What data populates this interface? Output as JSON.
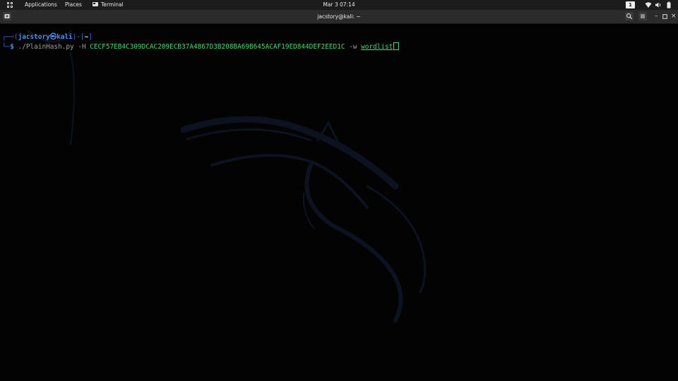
{
  "topbar": {
    "applications_label": "Applications",
    "places_label": "Places",
    "terminal_label": "Terminal",
    "clock": "Mar 3  07:14",
    "workspace": "1"
  },
  "window": {
    "title": "jacstory@kali: ~"
  },
  "terminal": {
    "prompt": {
      "frame_top": "┌──(",
      "user": "jacstory",
      "at_symbol": "㉿",
      "host": "kali",
      "frame_mid": ")-[",
      "dir": "~",
      "frame_end": "]",
      "frame_bottom": "└─",
      "dollar": "$"
    },
    "command": {
      "program": "./PlainHash.py",
      "flag_h": "-H",
      "hash": "CECF57EB4C309DCAC209ECB37A4867D3B208BA69B645ACAF19ED844DEF2EED1C",
      "flag_w": "-w",
      "wordlist": "wordlist"
    }
  },
  "icons": {
    "apps": "grid-icon",
    "terminal": "terminal-icon",
    "network": "wifi-icon",
    "sound": "speaker-icon",
    "power": "battery-icon",
    "search": "search-icon",
    "menu": "hamburger-icon",
    "new_tab": "new-tab-icon"
  },
  "colors": {
    "prompt_blue": "#4f8df0",
    "command_green": "#4ed66a",
    "background": "#030303"
  }
}
